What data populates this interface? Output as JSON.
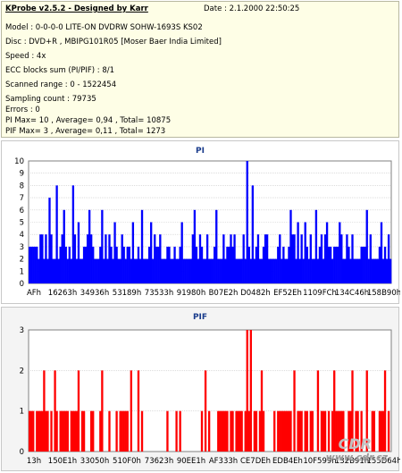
{
  "info": {
    "title": "KProbe v2.5.2 - Designed by Karr",
    "date": "Date : 2.1.2000 22:50:25",
    "lines": [
      "Model : 0-0-0-0 LITE-ON DVDRW SOHW-1693S KS02",
      "Disc : DVD+R , MBIPG101R05 [Moser Baer India Limited]",
      "Speed : 4x",
      "ECC blocks sum (PI/PIF) : 8/1",
      "Scanned range : 0 - 1522454",
      "Sampling count : 79735",
      "Errors : 0",
      "PI Max= 10 , Average= 0,94 , Total= 10875",
      "PIF Max= 3 , Average= 0,11 , Total= 1273"
    ]
  },
  "chart_data": [
    {
      "type": "bar",
      "title": "PI",
      "color": "#0000ff",
      "ylim": [
        0,
        10
      ],
      "yticks": [
        "0",
        "1",
        "2",
        "3",
        "4",
        "5",
        "6",
        "7",
        "8",
        "9",
        "10"
      ],
      "grid": true,
      "x_tick_labels": [
        "AFh",
        "16263h",
        "34936h",
        "53189h",
        "73533h",
        "91980h",
        "B07E2h",
        "D0482h",
        "EF52Eh",
        "1109FCh",
        "134C46h",
        "158B90h"
      ],
      "bins": 200,
      "baseline": 2,
      "typical": 3,
      "frequent": 4,
      "peaks": [
        {
          "at": 0.055,
          "value": 7
        },
        {
          "at": 0.075,
          "value": 8
        },
        {
          "at": 0.095,
          "value": 6
        },
        {
          "at": 0.12,
          "value": 8
        },
        {
          "at": 0.135,
          "value": 5
        },
        {
          "at": 0.165,
          "value": 6
        },
        {
          "at": 0.2,
          "value": 6
        },
        {
          "at": 0.235,
          "value": 5
        },
        {
          "at": 0.285,
          "value": 5
        },
        {
          "at": 0.31,
          "value": 6
        },
        {
          "at": 0.335,
          "value": 5
        },
        {
          "at": 0.42,
          "value": 5
        },
        {
          "at": 0.455,
          "value": 6
        },
        {
          "at": 0.515,
          "value": 6
        },
        {
          "at": 0.6,
          "value": 10
        },
        {
          "at": 0.615,
          "value": 8
        },
        {
          "at": 0.72,
          "value": 6
        },
        {
          "at": 0.74,
          "value": 5
        },
        {
          "at": 0.76,
          "value": 5
        },
        {
          "at": 0.79,
          "value": 6
        },
        {
          "at": 0.82,
          "value": 5
        },
        {
          "at": 0.855,
          "value": 5
        },
        {
          "at": 0.93,
          "value": 6
        },
        {
          "at": 0.97,
          "value": 5
        }
      ]
    },
    {
      "type": "bar",
      "title": "PIF",
      "color": "#ff0000",
      "ylim": [
        0,
        3
      ],
      "yticks": [
        "0",
        "1",
        "2",
        "3"
      ],
      "grid": true,
      "x_tick_labels": [
        "13h",
        "150E1h",
        "33050h",
        "510F0h",
        "73623h",
        "90EE1h",
        "AF333h",
        "CE7DEh",
        "EDB4Eh",
        "10F599h",
        "132B91h",
        "155D64h"
      ],
      "bins": 200,
      "gaps": [
        [
          0.315,
          0.335
        ],
        [
          0.44,
          0.47
        ],
        [
          0.48,
          0.49
        ],
        [
          0.5,
          0.515
        ],
        [
          0.655,
          0.67
        ]
      ],
      "peaks": [
        {
          "at": 0.04,
          "value": 2
        },
        {
          "at": 0.07,
          "value": 2
        },
        {
          "at": 0.135,
          "value": 2
        },
        {
          "at": 0.2,
          "value": 2
        },
        {
          "at": 0.28,
          "value": 2
        },
        {
          "at": 0.3,
          "value": 2
        },
        {
          "at": 0.485,
          "value": 2
        },
        {
          "at": 0.6,
          "value": 3
        },
        {
          "at": 0.61,
          "value": 3
        },
        {
          "at": 0.64,
          "value": 2
        },
        {
          "at": 0.73,
          "value": 2
        },
        {
          "at": 0.795,
          "value": 2
        },
        {
          "at": 0.84,
          "value": 2
        },
        {
          "at": 0.89,
          "value": 2
        },
        {
          "at": 0.93,
          "value": 2
        },
        {
          "at": 0.98,
          "value": 2
        }
      ]
    }
  ],
  "watermark": {
    "logo": "CDR",
    "text": "www.cdr.cz"
  }
}
